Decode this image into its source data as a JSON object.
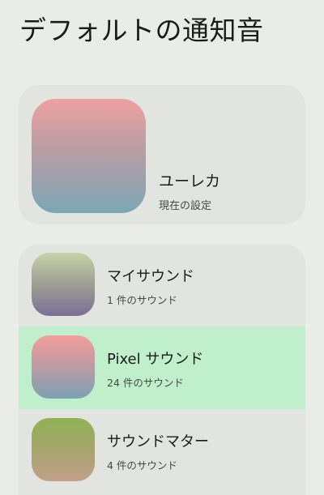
{
  "header": {
    "title": "デフォルトの通知音"
  },
  "current": {
    "name": "ユーレカ",
    "subtitle": "現在の設定"
  },
  "categories": [
    {
      "name": "マイサウンド",
      "count": "1 件のサウンド",
      "selected": false
    },
    {
      "name": "Pixel サウンド",
      "count": "24 件のサウンド",
      "selected": true
    },
    {
      "name": "サウンドマター",
      "count": "4 件のサウンド",
      "selected": false
    }
  ],
  "colors": {
    "background": "#e9ece7",
    "card": "#e2e5df",
    "selected_highlight": "#c0efcc"
  }
}
